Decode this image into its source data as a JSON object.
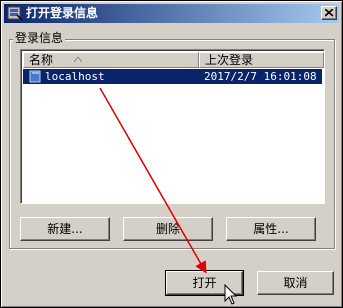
{
  "window": {
    "title": "打开登录信息",
    "close_glyph": "✕"
  },
  "group": {
    "label": "登录信息"
  },
  "listview": {
    "columns": [
      {
        "label": "名称"
      },
      {
        "label": "上次登录"
      }
    ],
    "rows": [
      {
        "name": "localhost",
        "last_login": "2017/2/7 16:01:08",
        "selected": true
      }
    ]
  },
  "buttons": {
    "new": "新建...",
    "delete": "删除",
    "properties": "属性...",
    "open": "打开",
    "cancel": "取消"
  },
  "colors": {
    "selection": "#0a246a",
    "annotation_arrow": "#e00000"
  },
  "icons": {
    "app": "db-connection-icon",
    "row": "database-icon",
    "sort": "sort-asc-icon"
  }
}
